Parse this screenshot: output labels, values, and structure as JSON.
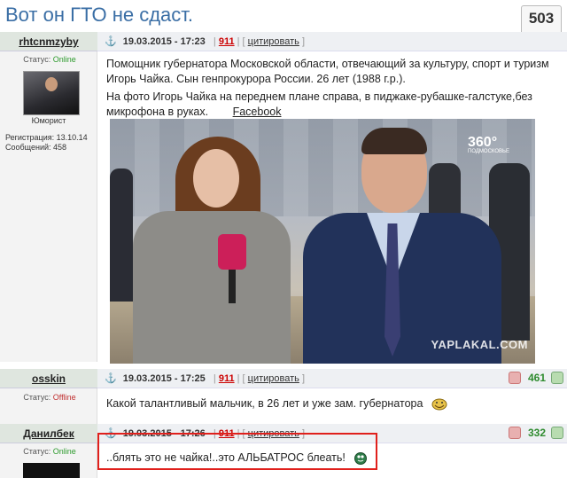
{
  "topic": {
    "title": "Вот он ГТО не сдаст."
  },
  "rating": {
    "value": "503",
    "minus": "−",
    "plus": "+"
  },
  "post1": {
    "author": "rhtcnmzyby",
    "status_label": "Статус:",
    "status": "Online",
    "rank": "Юморист",
    "reg": "Регистрация: 13.10.14",
    "messages": "Сообщений: 458",
    "date": "19.03.2015 - 17:23",
    "post_id": "911",
    "cite": "цитировать",
    "text1": "Помощник губернатора Московской области, отвечающий за культуру, спорт и туризм Игорь Чайка. Сын генпрокурора России. 26 лет (1988 г.р.).",
    "text2": "На фото Игорь Чайка на переднем плане справа, в пиджаке-рубашке-галстуке,без микрофона в руках.",
    "link": "Facebook",
    "photo_logo": "360°",
    "photo_logo_sub": "ПОДМОСКОВЬЕ",
    "photo_watermark": "YAPLAKAL.COM"
  },
  "post2": {
    "author": "osskin",
    "status_label": "Статус:",
    "status": "Offline",
    "date": "19.03.2015 - 17:25",
    "post_id": "911",
    "cite": "цитировать",
    "score": "461",
    "text": "Какой талантливый мальчик, в 26 лет и уже зам. губернатора"
  },
  "post3": {
    "author": "Данилбек",
    "status_label": "Статус:",
    "status": "Online",
    "date": "19.03.2015 - 17:26",
    "post_id": "911",
    "cite": "цитировать",
    "score": "332",
    "text": "..блять это не чайка!..это АЛЬБАТРОС блеать!"
  },
  "colors": {
    "online": "#2e9b2e",
    "offline": "#c03030",
    "score": "#2e8b2e",
    "title": "#3a6ea5",
    "highlight": "#e0201c"
  }
}
